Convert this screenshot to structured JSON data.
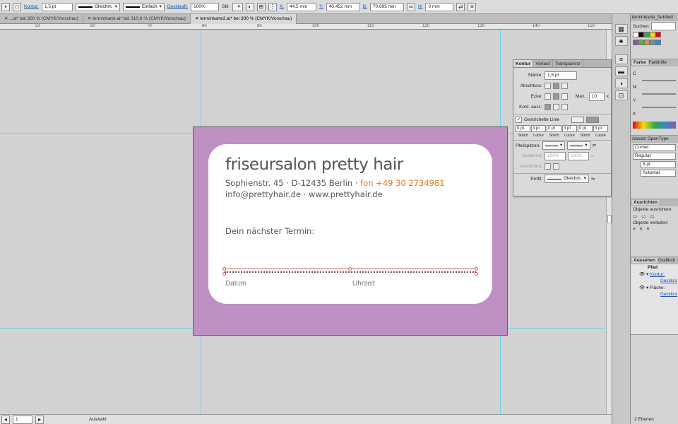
{
  "control_bar": {
    "kontur_label": "Kontur:",
    "stroke_weight": "1,5 pt",
    "profile1": "Gleichm.",
    "profile2": "Einfach",
    "opacity_label": "Deckkraft:",
    "opacity": "100%",
    "style_label": "Stil:",
    "x_label": "X:",
    "x_value": "44,5 mm",
    "y_label": "Y:",
    "y_value": "40,452 mm",
    "b_label": "B:",
    "b_value": "70,895 mm",
    "h_label": "H:",
    "h_value": "0 mm"
  },
  "tabs": [
    {
      "label": "...ai* bei 300 % (CMYK/Vorschau)"
    },
    {
      "label": "terminkarte.ai* bei 310,6 % (CMYK/Vorschau)"
    },
    {
      "label": "terminkarte2.ai* bei 300 % (CMYK/Vorschau)"
    }
  ],
  "ruler": [
    "50",
    "60",
    "70",
    "80",
    "90",
    "100",
    "110",
    "120",
    "130",
    "140",
    "150"
  ],
  "card": {
    "title": "friseursalon pretty hair",
    "address": "Sophienstr. 45 · D-12435 Berlin · ",
    "phone": "fon +49 30 2734981",
    "web": "info@prettyhair.de · www.prettyhair.de",
    "appointment": "Dein nächster Termin:",
    "date": "Datum",
    "time": "Uhrzeit"
  },
  "stroke_panel": {
    "tabs": [
      "Kontur",
      "Verlauf",
      "Transparenz"
    ],
    "weight_label": "Stärke:",
    "weight": "1,5 pt",
    "cap_label": "Abschluss:",
    "corner_label": "Ecke:",
    "miter_label": "Max.:",
    "miter": "10",
    "miter_unit": "x",
    "align_label": "Kont. ausr.:",
    "dashed_label": "Gestrichelte Linie",
    "dash_values": [
      "0 pt",
      "3 pt",
      "0 pt",
      "3 pt",
      "0 pt",
      "3 pt"
    ],
    "dash_labels": [
      "Strich",
      "Lücke",
      "Strich",
      "Lücke",
      "Strich",
      "Lücke"
    ],
    "arrow_label": "Pfeilspitzen:",
    "scale_label": "Skalieren:",
    "scale1": "100%",
    "scale2": "100%",
    "align_arrow_label": "Ausrichten:",
    "profile_label": "Profil:",
    "profile": "Gleichm."
  },
  "swatches_panel": {
    "title": "terminkarte_farbfeld",
    "search_label": "Suchen:",
    "colors": [
      "#ffffff",
      "#000000",
      "#2fa84f",
      "#f5e000",
      "#e30613",
      "#8a5a9e",
      "#6aa84f",
      "#bfa048",
      "#7a8a94",
      "#3a8ac4"
    ]
  },
  "color_panel": {
    "tabs": [
      "Farbe",
      "Farbhilfe"
    ],
    "channels": [
      "C",
      "M",
      "Y",
      "K"
    ]
  },
  "char_panel": {
    "tabs": [
      "Absatz",
      "OpenType"
    ],
    "font": "Corbel",
    "style": "Regular",
    "size": "8 pt",
    "leading": "Automat"
  },
  "align_panel": {
    "tab": "Ausrichten",
    "align_label": "Objekte ausrichten:",
    "dist_label": "Objekte verteilen:"
  },
  "appearance_panel": {
    "tabs": [
      "Aussehen",
      "Grafiksti"
    ],
    "path": "Pfad",
    "stroke": "Kontur:",
    "opacity": "Deckkra",
    "fill": "Fläche:",
    "opacity2": "Deckkra"
  },
  "layers_status": "2 Ebenen",
  "status_bar": {
    "page": "1",
    "tool": "Auswahl"
  }
}
